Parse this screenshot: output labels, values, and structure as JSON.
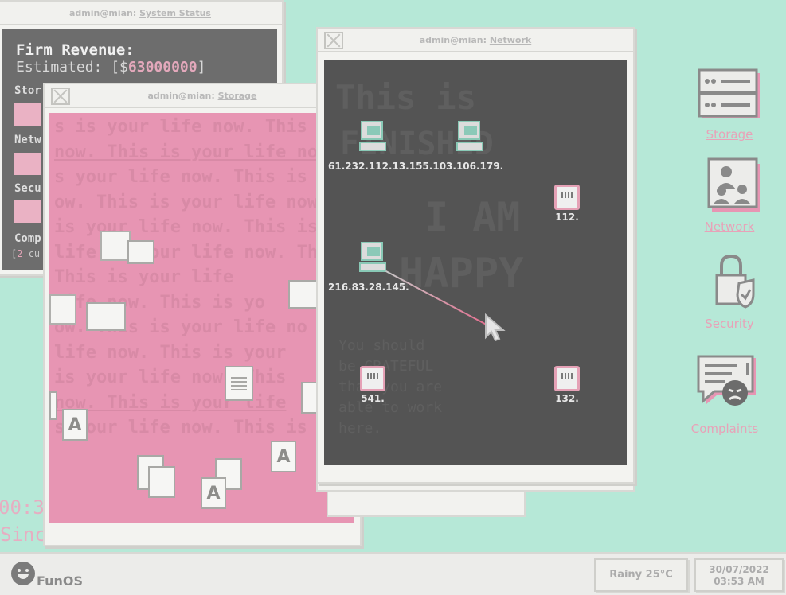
{
  "desktop": {
    "bg_time": "00:3",
    "bg_since": "Since Hire."
  },
  "status_window": {
    "title_user": "admin@mian:",
    "title_app": "System Status",
    "revenue_title": "Firm Revenue:",
    "revenue_prefix": "Estimated: [",
    "revenue_currency": "$",
    "revenue_amount": "63000000",
    "revenue_suffix": "]",
    "rows": [
      {
        "label": "Stor"
      },
      {
        "label": "Netw"
      },
      {
        "label": "Secu"
      },
      {
        "label": "Comp"
      }
    ],
    "complaints_open": "[",
    "complaints_count": "2",
    "complaints_text": " cu"
  },
  "storage_window": {
    "title_user": "admin@mian:",
    "title_app": "Storage",
    "bg_lines": [
      "s is your life now. This",
      "now. This is your life no",
      "s your life now. This is",
      "ow. This is your life now",
      "is your life now. This is yo",
      "life is your life now. Thi",
      "This is your life",
      "life now. This is yo",
      "ow. This is your life no",
      "life now. This is your",
      "is your life now. This",
      "now. This is your life",
      "s your life now. This is yo"
    ],
    "doc_letter": "A"
  },
  "network_window": {
    "title_user": "admin@mian:",
    "title_app": "Network",
    "bg_big": [
      "This is",
      "FINISHED",
      "I AM",
      "HAPPY"
    ],
    "bg_small": [
      "You should",
      "be GRATEFUL",
      "that you are",
      "able to work",
      "here."
    ],
    "nodes": [
      {
        "type": "computer",
        "label": "61.232.112.13."
      },
      {
        "type": "computer",
        "label": "155.103.106.179."
      },
      {
        "type": "router",
        "label": "112."
      },
      {
        "type": "computer",
        "label": "216.83.28.145."
      },
      {
        "type": "router",
        "label": "541."
      },
      {
        "type": "router",
        "label": "132."
      }
    ]
  },
  "desktop_icons": [
    {
      "label": "Storage",
      "icon": "storage-drive-icon"
    },
    {
      "label": "Network",
      "icon": "network-users-icon"
    },
    {
      "label": "Security",
      "icon": "padlock-shield-icon"
    },
    {
      "label": "Complaints",
      "icon": "complaint-angry-face-icon"
    }
  ],
  "taskbar": {
    "start_label": "FunOS",
    "weather": "Rainy 25°C",
    "date": "30/07/2022",
    "time": "03:53 AM"
  },
  "colors": {
    "desktop": "#b6e8d7",
    "accent_pink": "#e795b3",
    "network_bg": "#545454"
  }
}
